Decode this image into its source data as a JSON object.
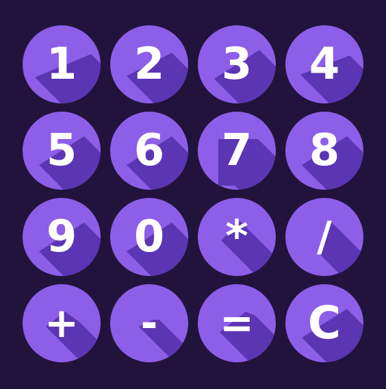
{
  "keypad": {
    "colors": {
      "background": "#22133d",
      "button": "#8d5ee8",
      "shadow": "#5b35b3",
      "text": "#ffffff"
    },
    "keys": [
      {
        "label": "1"
      },
      {
        "label": "2"
      },
      {
        "label": "3"
      },
      {
        "label": "4"
      },
      {
        "label": "5"
      },
      {
        "label": "6"
      },
      {
        "label": "7"
      },
      {
        "label": "8"
      },
      {
        "label": "9"
      },
      {
        "label": "0"
      },
      {
        "label": "*"
      },
      {
        "label": "/"
      },
      {
        "label": "+"
      },
      {
        "label": "-"
      },
      {
        "label": "="
      },
      {
        "label": "C"
      }
    ]
  }
}
